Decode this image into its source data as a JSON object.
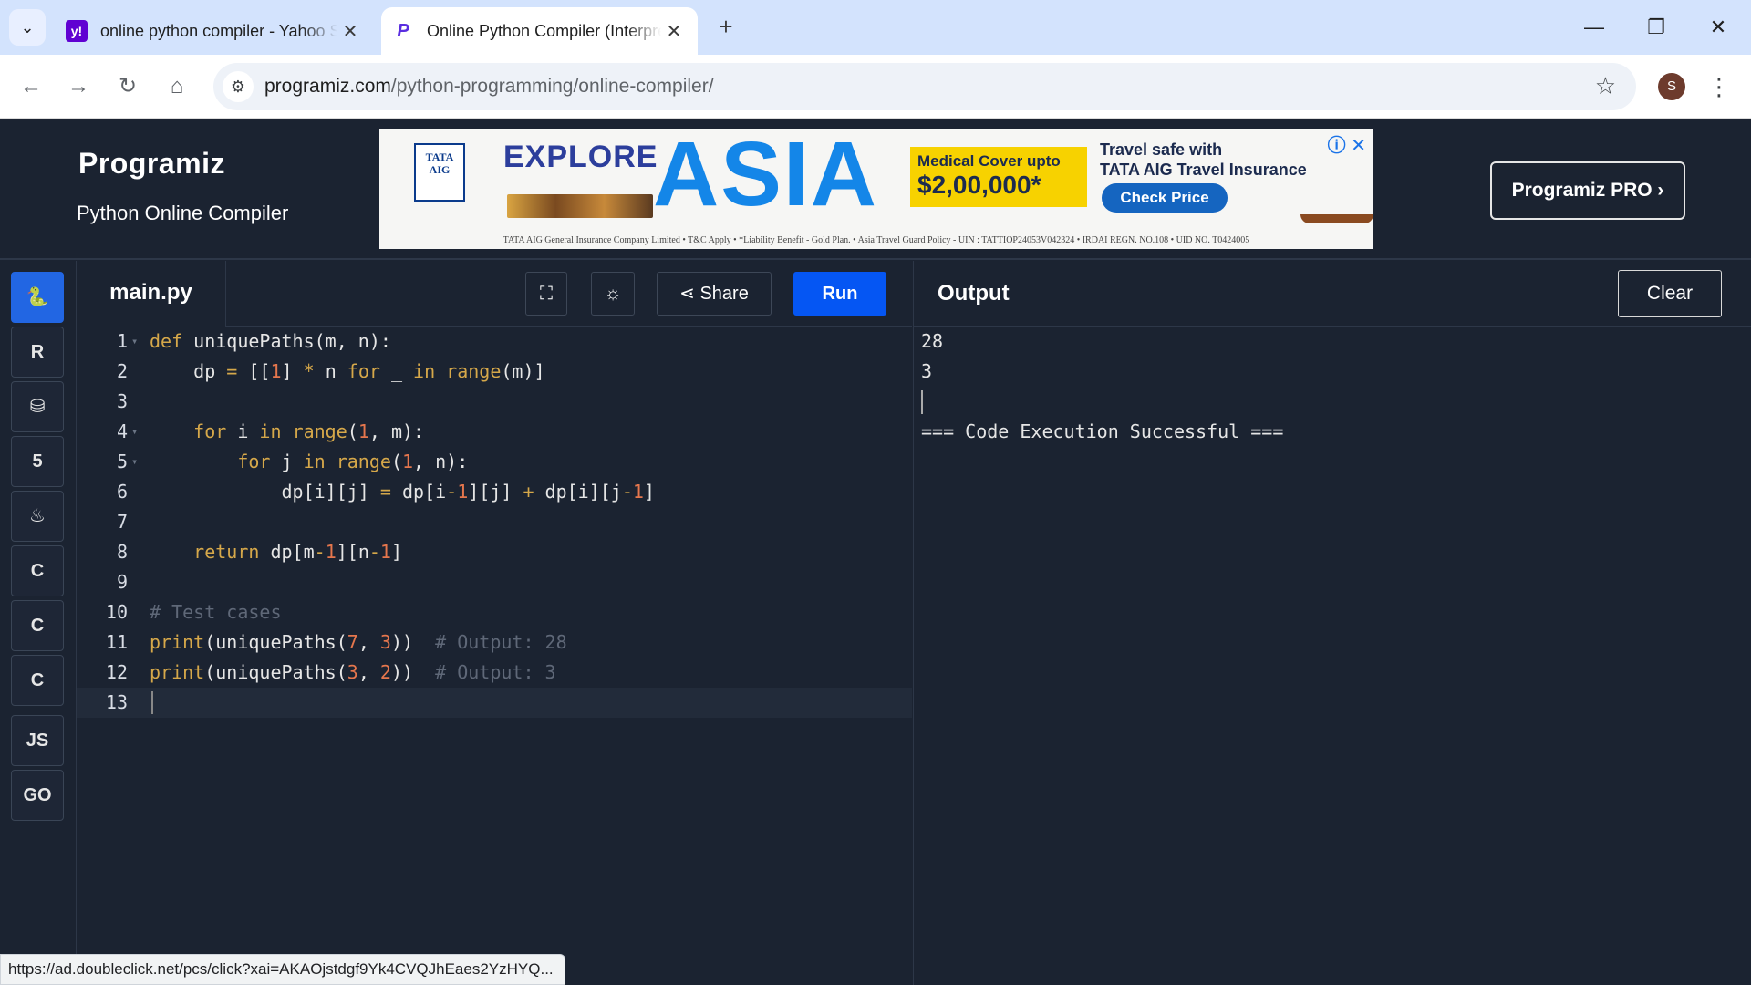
{
  "browser": {
    "tabs": [
      {
        "title": "online python compiler - Yahoo Search",
        "favicon": "yahoo-icon",
        "active": false
      },
      {
        "title": "Online Python Compiler (Interpreter)",
        "favicon": "programiz-icon",
        "active": true
      }
    ],
    "url_domain": "programiz.com",
    "url_path": "/python-programming/online-compiler/",
    "profile_initial": "S",
    "status_link": "https://ad.doubleclick.net/pcs/click?xai=AKAOjstdgf9Yk4CVQJhEaes2YzHYQ..."
  },
  "header": {
    "logo": "Programiz",
    "subtitle": "Python Online Compiler",
    "pro_button": "Programiz PRO ›"
  },
  "ad": {
    "brand": "TATA AIG",
    "headline_explore": "EXPLORE",
    "headline_asia": "ASIA",
    "medical_line1": "Medical Cover upto",
    "medical_line2": "$2,00,000*",
    "travel_line1": "Travel safe with",
    "travel_line2": "TATA AIG Travel Insurance",
    "cta": "Check Price",
    "footer": "TATA AIG General Insurance Company Limited • T&C Apply • *Liability Benefit - Gold Plan. • Asia Travel Guard Policy - UIN : TATTIOP24053V042324 • IRDAI REGN. NO.108 • UID NO. T0424005"
  },
  "rail": {
    "items": [
      {
        "name": "python-icon",
        "label": "🐍"
      },
      {
        "name": "r-icon",
        "label": "R"
      },
      {
        "name": "database-icon",
        "label": "⛁"
      },
      {
        "name": "html5-icon",
        "label": "5"
      },
      {
        "name": "java-icon",
        "label": "♨"
      },
      {
        "name": "c-icon",
        "label": "C"
      },
      {
        "name": "cpp-icon",
        "label": "C"
      },
      {
        "name": "csharp-icon",
        "label": "C"
      },
      {
        "name": "javascript-icon",
        "label": "JS"
      },
      {
        "name": "go-icon",
        "label": "GO"
      }
    ]
  },
  "editor": {
    "file_name": "main.py",
    "share_label": "Share",
    "run_label": "Run",
    "lines": [
      "def uniquePaths(m, n):",
      "    dp = [[1] * n for _ in range(m)]",
      "",
      "    for i in range(1, m):",
      "        for j in range(1, n):",
      "            dp[i][j] = dp[i-1][j] + dp[i][j-1]",
      "",
      "    return dp[m-1][n-1]",
      "",
      "# Test cases",
      "print(uniquePaths(7, 3))  # Output: 28",
      "print(uniquePaths(3, 2))  # Output: 3",
      ""
    ]
  },
  "output": {
    "title": "Output",
    "clear_label": "Clear",
    "lines": [
      "28",
      "3",
      "",
      "=== Code Execution Successful ==="
    ]
  }
}
